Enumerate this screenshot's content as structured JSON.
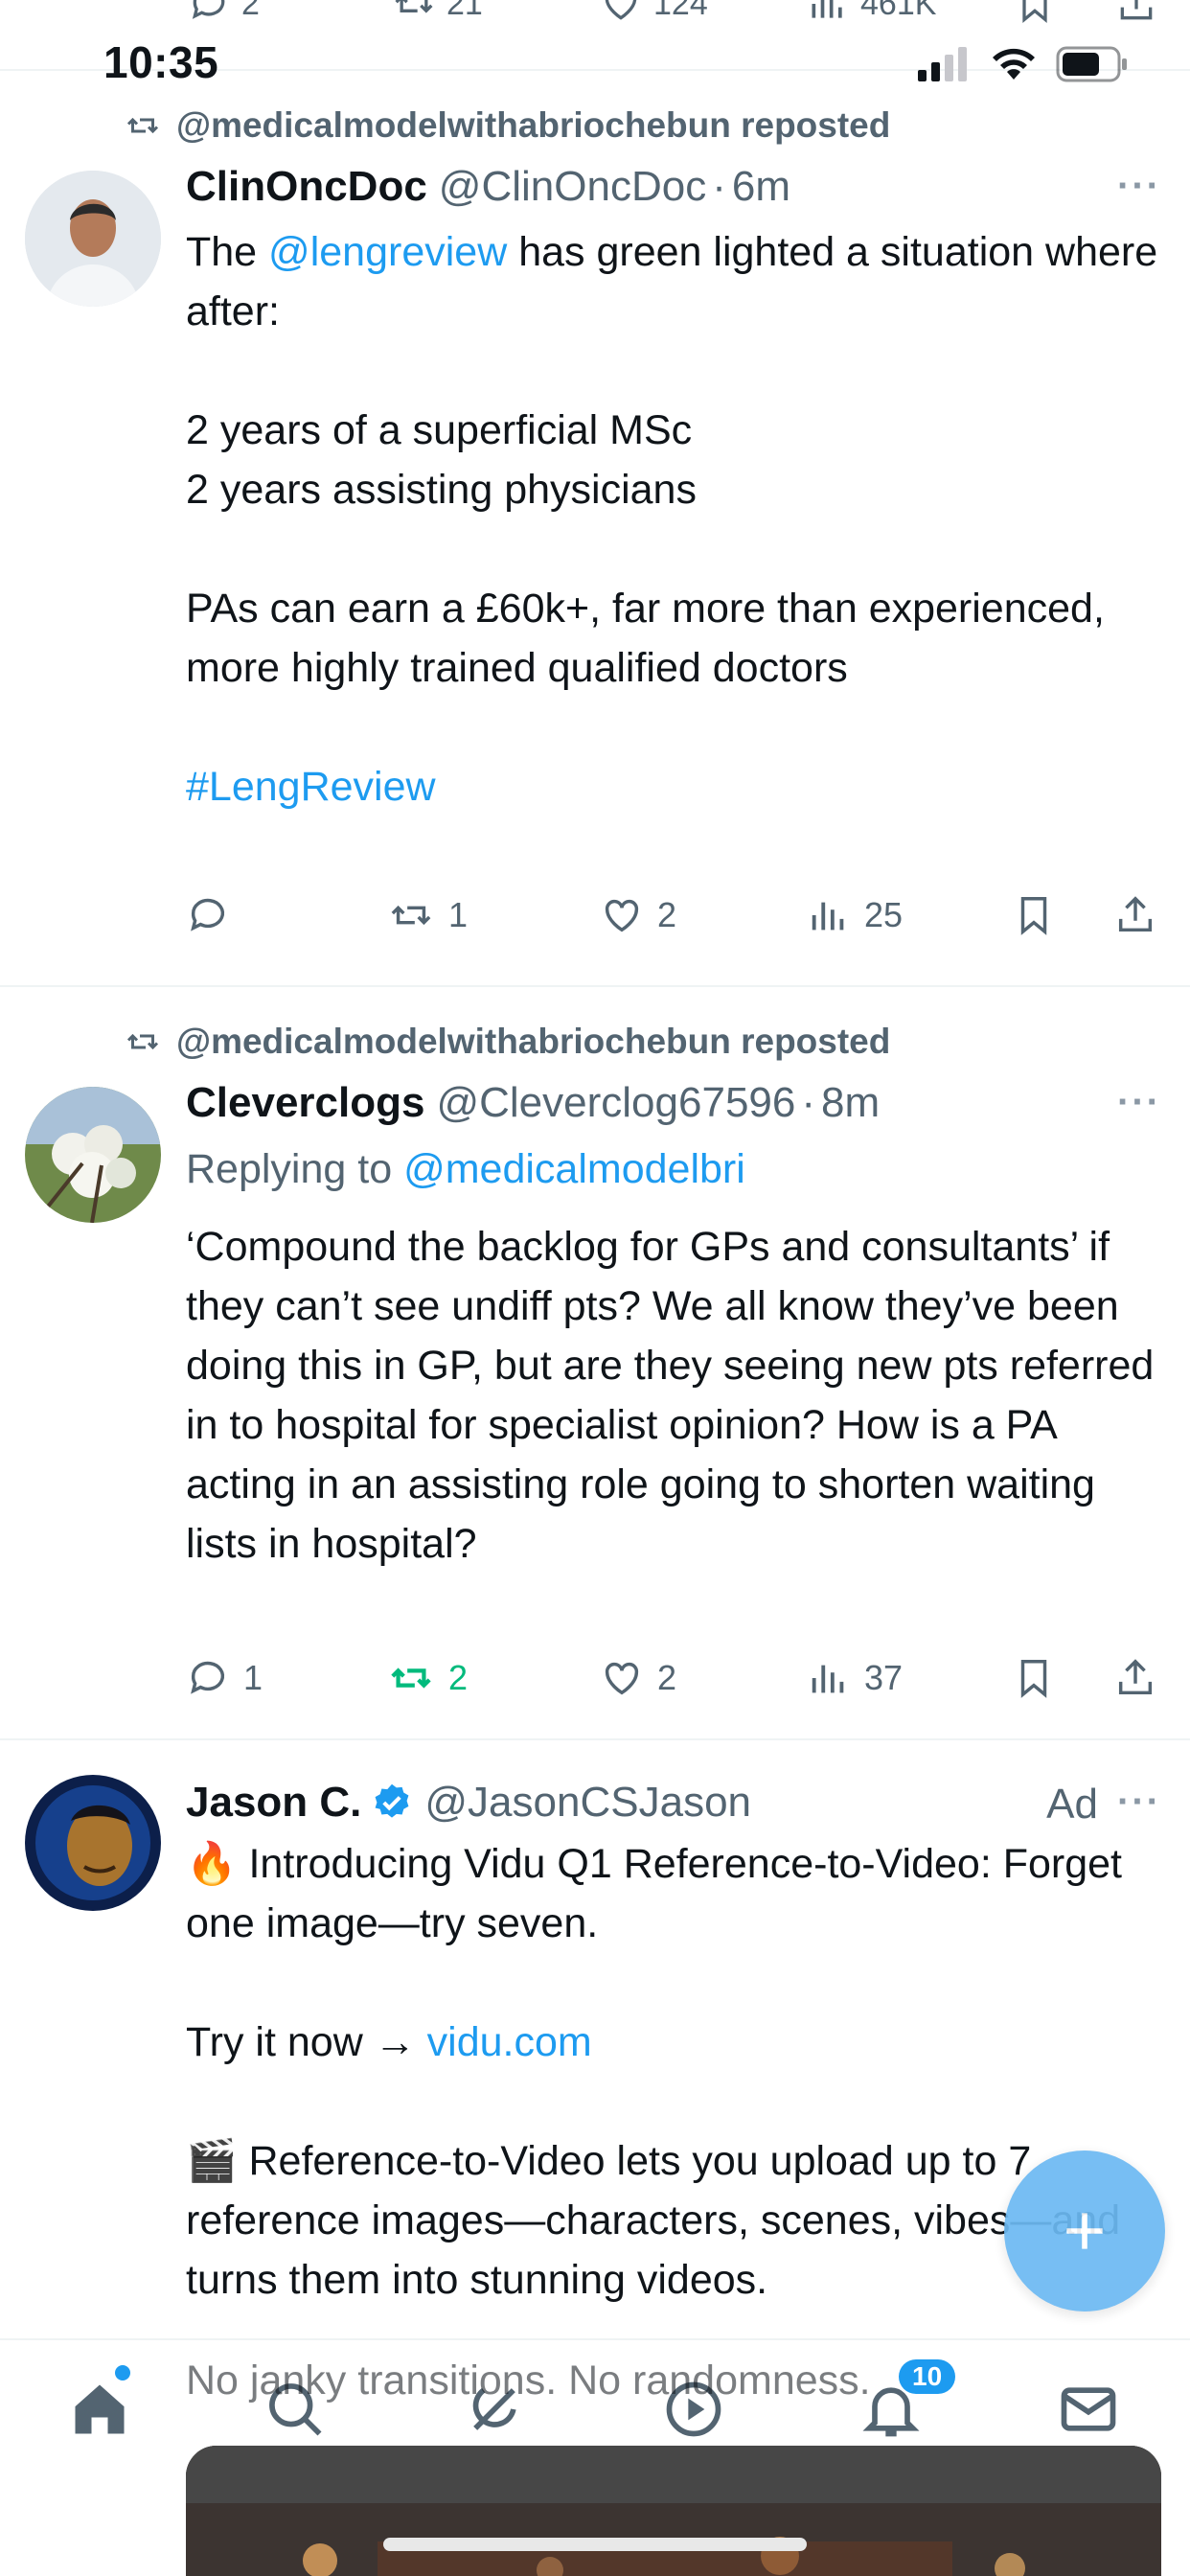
{
  "top_actions": {
    "replies": "2",
    "reposts": "21",
    "likes": "124",
    "views": "461K"
  },
  "status_bar": {
    "time": "10:35"
  },
  "tweets": [
    {
      "repost_by": "@medicalmodelwithabriochebun reposted",
      "name": "ClinOncDoc",
      "handle": "@ClinOncDoc",
      "dot": "·",
      "time": "6m",
      "more": "···",
      "body_pre": "The ",
      "mention": "@lengreview",
      "body_post": " has green lighted a situation where after:",
      "para2": "2 years of a superficial MSc\n2 years assisting physicians",
      "para3": "PAs can earn a £60k+, far more than experienced, more highly trained qualified doctors",
      "hashtag": "#LengReview",
      "stats": {
        "replies": "",
        "reposts": "1",
        "likes": "2",
        "views": "25"
      }
    },
    {
      "repost_by": "@medicalmodelwithabriochebun reposted",
      "name": "Cleverclogs",
      "handle": "@Cleverclog67596",
      "dot": "·",
      "time": "8m",
      "more": "···",
      "replying_prefix": "Replying to ",
      "replying_to": "@medicalmodelbri",
      "body": "‘Compound the backlog for GPs and consultants’ if they can’t see undiff pts? We all know they’ve been doing this in GP, but are they seeing new pts referred in to hospital for specialist opinion? How is a PA acting in an assisting role going to shorten waiting lists in hospital?",
      "stats": {
        "replies": "1",
        "reposts": "2",
        "likes": "2",
        "views": "37"
      }
    },
    {
      "name": "Jason C.",
      "handle": "@JasonCSJason",
      "ad_label": "Ad",
      "more": "···",
      "line1": "🔥 Introducing Vidu Q1 Reference-to-Video: Forget one image—try seven.",
      "try_prefix": "Try it now → ",
      "try_link": "vidu.com",
      "line3": "🎬 Reference-to-Video lets you upload up to 7 reference images—characters, scenes, vibes—and turns them into stunning videos.",
      "line4": "No janky transitions. No randomness."
    }
  ],
  "bottom_nav": {
    "notifications_badge": "10"
  },
  "colors": {
    "accent": "#1d9bf0",
    "repost_green": "#00ba7c",
    "muted": "#536471",
    "text": "#0f1419"
  },
  "icons": [
    "reply-icon",
    "repost-icon",
    "like-icon",
    "views-icon",
    "bookmark-icon",
    "share-icon",
    "verified-icon",
    "home-icon",
    "search-icon",
    "grok-icon",
    "play-icon",
    "bell-icon",
    "mail-icon",
    "compose-icon"
  ]
}
